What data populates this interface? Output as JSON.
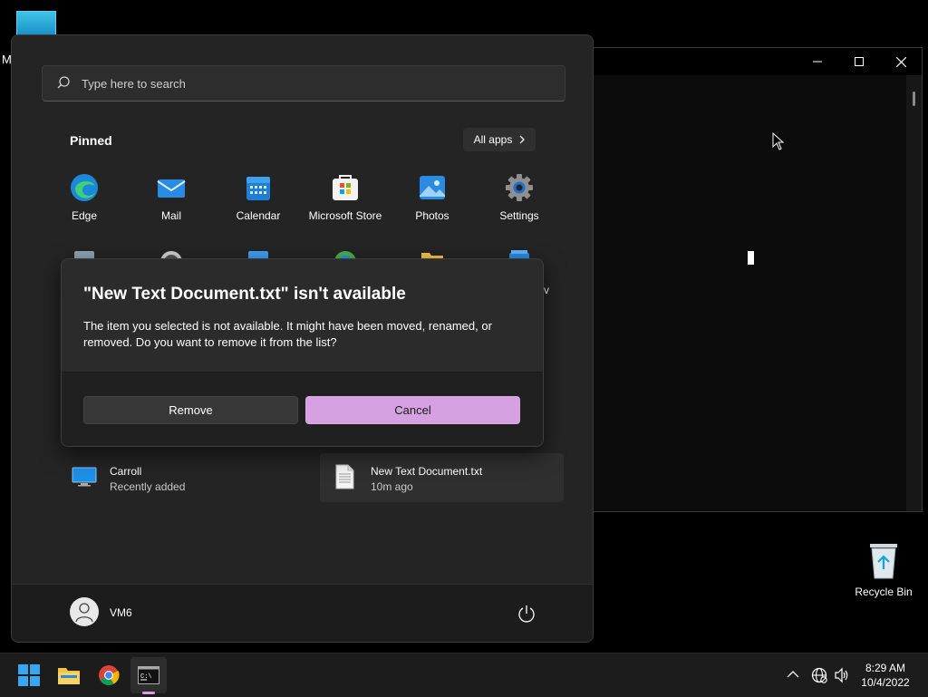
{
  "desktop": {
    "partial_label": "M",
    "recycle_bin_label": "Recycle Bin"
  },
  "start_menu": {
    "search_placeholder": "Type here to search",
    "pinned_title": "Pinned",
    "all_apps_label": "All apps",
    "pinned_apps": [
      {
        "label": "Edge",
        "icon": "edge-icon"
      },
      {
        "label": "Mail",
        "icon": "mail-icon"
      },
      {
        "label": "Calendar",
        "icon": "calendar-icon"
      },
      {
        "label": "Microsoft Store",
        "icon": "store-icon"
      },
      {
        "label": "Photos",
        "icon": "photos-icon"
      },
      {
        "label": "Settings",
        "icon": "settings-icon"
      }
    ],
    "second_row_partial_label": "v",
    "recommended": [
      {
        "name": "Carroll",
        "sub": "Recently added",
        "icon": "monitor-icon"
      },
      {
        "name": "New Text Document.txt",
        "sub": "10m ago",
        "icon": "document-icon"
      }
    ],
    "user_name": "VM6"
  },
  "dialog": {
    "title": "\"New Text Document.txt\" isn't available",
    "body": "The item you selected is not available. It might have been moved, renamed, or removed. Do you want to remove it from the list?",
    "remove_label": "Remove",
    "cancel_label": "Cancel"
  },
  "taskbar": {
    "time": "8:29 AM",
    "date": "10/4/2022",
    "accent_color": "#d6a1e0"
  }
}
